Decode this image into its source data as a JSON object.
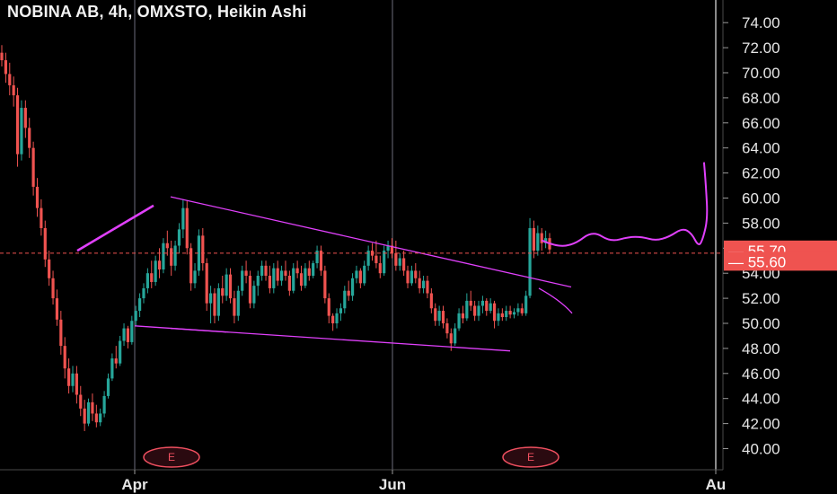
{
  "header": {
    "title": "NOBINA AB, 4h, OMXSTO, Heikin Ashi"
  },
  "colors": {
    "background": "#000000",
    "up": "#26a69a",
    "down": "#ef5350",
    "drawing": "#e040fb",
    "grid": "#3a3a44",
    "axis_text": "#e6e6e6",
    "price_label_bg": "#ef5350"
  },
  "chart_data": {
    "type": "candlestick",
    "symbol": "NOBINA AB",
    "interval": "4h",
    "exchange": "OMXSTO",
    "style": "Heikin Ashi",
    "y_axis": {
      "ticks": [
        "40.00",
        "42.00",
        "44.00",
        "46.00",
        "48.00",
        "50.00",
        "52.00",
        "54.00",
        "56.00",
        "58.00",
        "60.00",
        "62.00",
        "64.00",
        "66.00",
        "68.00",
        "70.00",
        "72.00",
        "74.00"
      ],
      "range": [
        39,
        75.5
      ]
    },
    "x_axis": {
      "labels": [
        "Apr",
        "Jun",
        "Au"
      ]
    },
    "price_labels": [
      "55.70",
      "55.60"
    ],
    "current_price": 55.6,
    "earnings_markers": [
      "E",
      "E"
    ],
    "candles": [
      [
        71.6,
        72.2,
        70.5,
        71.0
      ],
      [
        71.0,
        71.6,
        69.2,
        69.9
      ],
      [
        69.9,
        70.8,
        68.2,
        69.0
      ],
      [
        69.0,
        69.7,
        67.3,
        68.2
      ],
      [
        68.2,
        68.8,
        62.5,
        63.5
      ],
      [
        63.5,
        67.8,
        63.0,
        67.2
      ],
      [
        67.2,
        67.8,
        64.8,
        65.6
      ],
      [
        65.6,
        66.4,
        63.2,
        64.0
      ],
      [
        64.0,
        64.5,
        60.2,
        60.9
      ],
      [
        60.9,
        61.6,
        58.5,
        59.2
      ],
      [
        59.2,
        59.9,
        57.0,
        57.6
      ],
      [
        57.6,
        58.2,
        54.5,
        55.1
      ],
      [
        55.1,
        55.8,
        53.0,
        53.6
      ],
      [
        53.6,
        54.2,
        51.5,
        52.0
      ],
      [
        52.0,
        52.7,
        49.8,
        50.3
      ],
      [
        50.3,
        51.0,
        47.5,
        48.2
      ],
      [
        48.2,
        48.9,
        45.6,
        46.4
      ],
      [
        46.4,
        47.2,
        44.4,
        45.0
      ],
      [
        45.0,
        46.6,
        44.5,
        46.0
      ],
      [
        46.0,
        46.6,
        43.6,
        44.3
      ],
      [
        44.3,
        45.0,
        42.6,
        43.2
      ],
      [
        43.2,
        43.9,
        41.4,
        42.0
      ],
      [
        42.0,
        44.0,
        41.8,
        43.7
      ],
      [
        43.7,
        44.4,
        42.2,
        42.8
      ],
      [
        42.8,
        43.5,
        41.7,
        42.1
      ],
      [
        42.1,
        43.2,
        41.8,
        42.8
      ],
      [
        42.8,
        44.6,
        42.5,
        44.2
      ],
      [
        44.2,
        46.0,
        44.0,
        45.6
      ],
      [
        45.6,
        47.6,
        45.4,
        47.2
      ],
      [
        47.2,
        48.2,
        46.4,
        46.8
      ],
      [
        46.8,
        49.0,
        46.6,
        48.6
      ],
      [
        48.6,
        50.0,
        48.2,
        49.6
      ],
      [
        49.6,
        49.8,
        48.0,
        48.5
      ],
      [
        48.5,
        50.6,
        48.3,
        50.2
      ],
      [
        50.2,
        51.4,
        49.8,
        51.0
      ],
      [
        51.0,
        52.4,
        50.5,
        52.0
      ],
      [
        52.0,
        53.2,
        51.6,
        52.8
      ],
      [
        52.8,
        54.4,
        52.4,
        54.0
      ],
      [
        54.0,
        55.0,
        52.8,
        53.3
      ],
      [
        53.3,
        55.4,
        53.0,
        55.0
      ],
      [
        55.0,
        56.0,
        53.6,
        54.3
      ],
      [
        54.3,
        56.8,
        54.0,
        56.4
      ],
      [
        56.4,
        57.4,
        55.4,
        56.0
      ],
      [
        56.0,
        56.6,
        53.8,
        54.6
      ],
      [
        54.6,
        56.6,
        54.2,
        56.2
      ],
      [
        56.2,
        58.0,
        55.6,
        57.5
      ],
      [
        57.5,
        59.9,
        56.8,
        59.2
      ],
      [
        59.2,
        59.8,
        55.5,
        56.0
      ],
      [
        56.0,
        56.4,
        52.6,
        53.2
      ],
      [
        53.2,
        54.8,
        52.8,
        54.2
      ],
      [
        54.2,
        57.5,
        53.8,
        57.0
      ],
      [
        57.0,
        57.6,
        54.2,
        54.8
      ],
      [
        54.8,
        55.2,
        51.0,
        51.6
      ],
      [
        51.6,
        53.0,
        50.0,
        52.4
      ],
      [
        52.4,
        52.8,
        50.0,
        50.6
      ],
      [
        50.6,
        53.2,
        50.2,
        52.8
      ],
      [
        52.8,
        53.8,
        51.6,
        52.2
      ],
      [
        52.2,
        54.4,
        51.8,
        53.9
      ],
      [
        53.9,
        54.4,
        51.6,
        52.0
      ],
      [
        52.0,
        52.6,
        50.0,
        50.6
      ],
      [
        50.6,
        53.0,
        50.2,
        52.6
      ],
      [
        52.6,
        54.6,
        52.2,
        54.2
      ],
      [
        54.2,
        55.0,
        53.2,
        53.8
      ],
      [
        53.8,
        54.2,
        51.2,
        51.6
      ],
      [
        51.6,
        53.4,
        51.2,
        53.0
      ],
      [
        53.0,
        54.2,
        52.2,
        53.8
      ],
      [
        53.8,
        55.0,
        53.4,
        54.6
      ],
      [
        54.6,
        55.0,
        53.4,
        53.8
      ],
      [
        53.8,
        54.6,
        52.4,
        52.8
      ],
      [
        52.8,
        54.8,
        52.4,
        54.4
      ],
      [
        54.4,
        55.0,
        53.0,
        53.4
      ],
      [
        53.4,
        54.6,
        53.0,
        54.2
      ],
      [
        54.2,
        55.0,
        53.4,
        53.8
      ],
      [
        53.8,
        54.2,
        52.2,
        52.6
      ],
      [
        52.6,
        54.8,
        52.4,
        54.4
      ],
      [
        54.4,
        55.0,
        53.6,
        54.0
      ],
      [
        54.0,
        54.6,
        52.6,
        53.0
      ],
      [
        53.0,
        54.8,
        52.8,
        54.4
      ],
      [
        54.4,
        55.0,
        53.4,
        53.8
      ],
      [
        53.8,
        55.0,
        53.6,
        54.8
      ],
      [
        54.8,
        56.2,
        54.4,
        55.8
      ],
      [
        55.8,
        56.2,
        53.8,
        54.2
      ],
      [
        54.2,
        54.6,
        51.6,
        52.0
      ],
      [
        52.0,
        52.4,
        50.0,
        50.6
      ],
      [
        50.6,
        50.8,
        49.4,
        50.0
      ],
      [
        50.0,
        51.2,
        49.6,
        50.8
      ],
      [
        50.8,
        51.6,
        50.2,
        51.2
      ],
      [
        51.2,
        53.0,
        50.8,
        52.6
      ],
      [
        52.6,
        53.4,
        51.8,
        52.2
      ],
      [
        52.2,
        54.0,
        51.8,
        53.6
      ],
      [
        53.6,
        54.6,
        53.2,
        54.2
      ],
      [
        54.2,
        54.4,
        52.8,
        53.2
      ],
      [
        53.2,
        55.0,
        53.0,
        54.6
      ],
      [
        54.6,
        56.2,
        54.2,
        55.8
      ],
      [
        55.8,
        56.4,
        55.0,
        55.4
      ],
      [
        55.4,
        56.6,
        54.4,
        54.8
      ],
      [
        54.8,
        55.4,
        53.6,
        54.0
      ],
      [
        54.0,
        56.2,
        53.8,
        55.8
      ],
      [
        55.8,
        56.6,
        55.2,
        56.2
      ],
      [
        56.2,
        56.8,
        55.2,
        55.6
      ],
      [
        55.6,
        56.6,
        54.2,
        54.6
      ],
      [
        54.6,
        55.6,
        54.2,
        55.2
      ],
      [
        55.2,
        55.8,
        53.8,
        54.2
      ],
      [
        54.2,
        54.6,
        52.8,
        53.2
      ],
      [
        53.2,
        54.6,
        53.0,
        54.2
      ],
      [
        54.2,
        54.8,
        53.2,
        53.6
      ],
      [
        53.6,
        54.2,
        52.4,
        52.8
      ],
      [
        52.8,
        53.8,
        52.4,
        53.4
      ],
      [
        53.4,
        53.8,
        52.0,
        52.4
      ],
      [
        52.4,
        52.8,
        50.8,
        51.2
      ],
      [
        51.2,
        51.6,
        49.8,
        50.2
      ],
      [
        50.2,
        51.4,
        49.8,
        51.0
      ],
      [
        51.0,
        51.4,
        49.6,
        50.0
      ],
      [
        50.0,
        50.4,
        48.8,
        49.2
      ],
      [
        49.2,
        49.6,
        47.8,
        48.4
      ],
      [
        48.4,
        50.0,
        48.2,
        49.6
      ],
      [
        49.6,
        51.2,
        49.4,
        50.8
      ],
      [
        50.8,
        51.4,
        50.0,
        50.4
      ],
      [
        50.4,
        52.4,
        50.2,
        51.8
      ],
      [
        51.8,
        52.6,
        51.0,
        51.4
      ],
      [
        51.4,
        51.8,
        50.2,
        50.6
      ],
      [
        50.6,
        51.8,
        50.2,
        51.4
      ],
      [
        51.4,
        52.2,
        50.8,
        51.8
      ],
      [
        51.8,
        52.0,
        50.6,
        51.0
      ],
      [
        51.0,
        52.0,
        50.8,
        51.6
      ],
      [
        51.6,
        51.8,
        49.6,
        50.2
      ],
      [
        50.2,
        51.2,
        49.8,
        50.8
      ],
      [
        50.8,
        51.2,
        50.2,
        50.5
      ],
      [
        50.5,
        51.4,
        50.2,
        51.0
      ],
      [
        51.0,
        51.4,
        50.4,
        50.7
      ],
      [
        50.7,
        51.2,
        50.4,
        50.9
      ],
      [
        50.9,
        51.6,
        50.6,
        51.2
      ],
      [
        51.2,
        51.6,
        50.6,
        50.8
      ],
      [
        50.8,
        52.6,
        50.6,
        52.2
      ],
      [
        52.2,
        58.4,
        52.0,
        57.6
      ],
      [
        57.6,
        58.2,
        55.2,
        55.8
      ],
      [
        55.8,
        57.8,
        55.4,
        57.2
      ],
      [
        57.2,
        57.6,
        55.8,
        56.4
      ],
      [
        56.4,
        57.4,
        56.0,
        56.8
      ],
      [
        56.8,
        57.2,
        55.6,
        55.9
      ]
    ],
    "drawings": [
      {
        "type": "trendline",
        "points": [
          [
            86,
            55.8
          ],
          [
            171,
            59.4
          ]
        ]
      },
      {
        "type": "trendline",
        "points": [
          [
            190,
            60.1
          ],
          [
            636,
            52.9
          ]
        ]
      },
      {
        "type": "trendline",
        "points": [
          [
            150,
            49.8
          ],
          [
            568,
            47.8
          ]
        ]
      },
      {
        "type": "trendline",
        "points": [
          [
            190,
            49.6
          ],
          [
            252,
            49.3
          ]
        ]
      },
      {
        "type": "projection",
        "points": [
          [
            604,
            56.6
          ],
          [
            620,
            56.1
          ],
          [
            640,
            56.3
          ],
          [
            660,
            57.4
          ],
          [
            680,
            56.5
          ],
          [
            700,
            56.9
          ],
          [
            715,
            56.9
          ],
          [
            730,
            56.6
          ],
          [
            745,
            56.9
          ],
          [
            760,
            57.6
          ],
          [
            770,
            57.2
          ],
          [
            778,
            56.1
          ],
          [
            783,
            56.8
          ],
          [
            788,
            58.4
          ],
          [
            786,
            61.0
          ],
          [
            784,
            62.8
          ]
        ]
      }
    ]
  }
}
